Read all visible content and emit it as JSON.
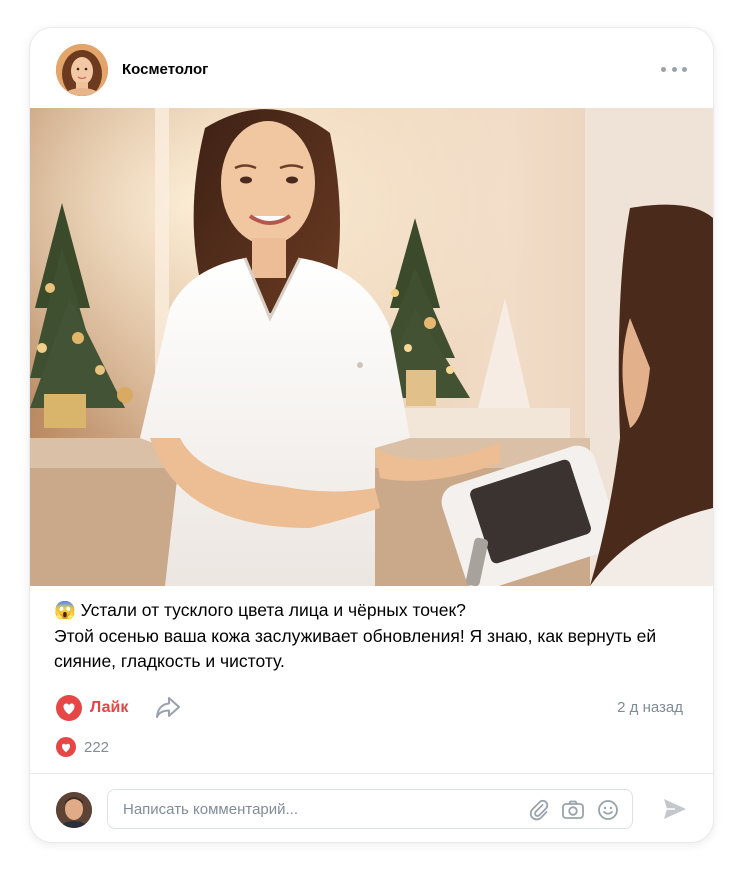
{
  "post": {
    "author": "Косметолог",
    "text_lines": [
      "😱 Устали от тусклого цвета лица и чёрных точек?",
      "Этой осенью ваша кожа заслуживает обновления! Я знаю, как вернуть ей",
      "сияние, гладкость и чистоту."
    ],
    "time": "2 д назад"
  },
  "actions": {
    "like_label": "Лайк",
    "likes_count": "222"
  },
  "comment": {
    "placeholder": "Написать комментарий..."
  },
  "icons": {
    "more": "more-horizontal-icon",
    "like": "heart-icon",
    "share": "share-icon",
    "attach": "paperclip-icon",
    "camera": "camera-icon",
    "emoji": "smile-icon",
    "send": "send-icon"
  },
  "colors": {
    "accent_red": "#e64646",
    "muted_text": "#818c99",
    "icon_gray": "#99a2ad"
  }
}
